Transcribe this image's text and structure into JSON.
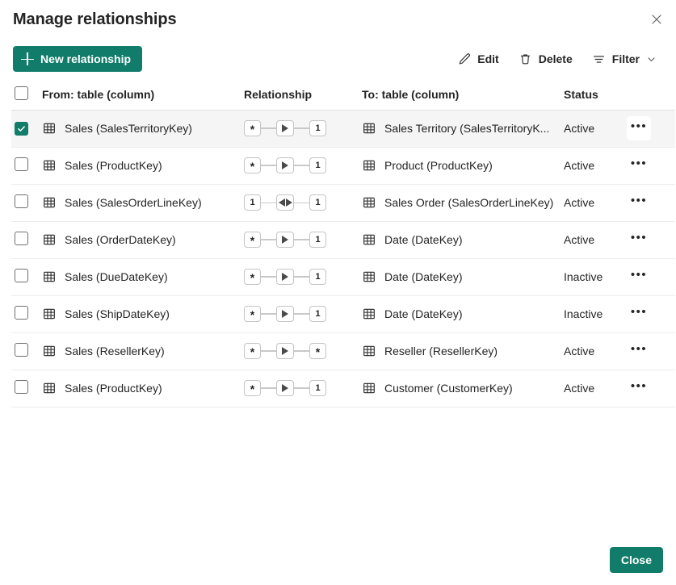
{
  "dialog": {
    "title": "Manage relationships",
    "close_icon": "close-icon"
  },
  "toolbar": {
    "new_relationship_label": "New relationship",
    "edit_label": "Edit",
    "delete_label": "Delete",
    "filter_label": "Filter"
  },
  "table": {
    "headers": {
      "from": "From: table (column)",
      "relationship": "Relationship",
      "to": "To: table (column)",
      "status": "Status"
    },
    "rows": [
      {
        "selected": true,
        "from": "Sales (SalesTerritoryKey)",
        "from_cardinality": "*",
        "direction": "single",
        "to_cardinality": "1",
        "to": "Sales Territory (SalesTerritoryK...",
        "status": "Active"
      },
      {
        "selected": false,
        "from": "Sales (ProductKey)",
        "from_cardinality": "*",
        "direction": "single",
        "to_cardinality": "1",
        "to": "Product (ProductKey)",
        "status": "Active"
      },
      {
        "selected": false,
        "from": "Sales (SalesOrderLineKey)",
        "from_cardinality": "1",
        "direction": "both",
        "to_cardinality": "1",
        "to": "Sales Order (SalesOrderLineKey)",
        "status": "Active"
      },
      {
        "selected": false,
        "from": "Sales (OrderDateKey)",
        "from_cardinality": "*",
        "direction": "single",
        "to_cardinality": "1",
        "to": "Date (DateKey)",
        "status": "Active"
      },
      {
        "selected": false,
        "from": "Sales (DueDateKey)",
        "from_cardinality": "*",
        "direction": "single",
        "to_cardinality": "1",
        "to": "Date (DateKey)",
        "status": "Inactive"
      },
      {
        "selected": false,
        "from": "Sales (ShipDateKey)",
        "from_cardinality": "*",
        "direction": "single",
        "to_cardinality": "1",
        "to": "Date (DateKey)",
        "status": "Inactive"
      },
      {
        "selected": false,
        "from": "Sales (ResellerKey)",
        "from_cardinality": "*",
        "direction": "single",
        "to_cardinality": "*",
        "to": "Reseller (ResellerKey)",
        "status": "Active"
      },
      {
        "selected": false,
        "from": "Sales (ProductKey)",
        "from_cardinality": "*",
        "direction": "single",
        "to_cardinality": "1",
        "to": "Customer (CustomerKey)",
        "status": "Active"
      }
    ],
    "more_glyph": "•••"
  },
  "footer": {
    "close_label": "Close"
  },
  "colors": {
    "accent": "#107c69",
    "selected_row": "#f5f5f5",
    "border": "#e0e0e0",
    "text": "#242424"
  }
}
